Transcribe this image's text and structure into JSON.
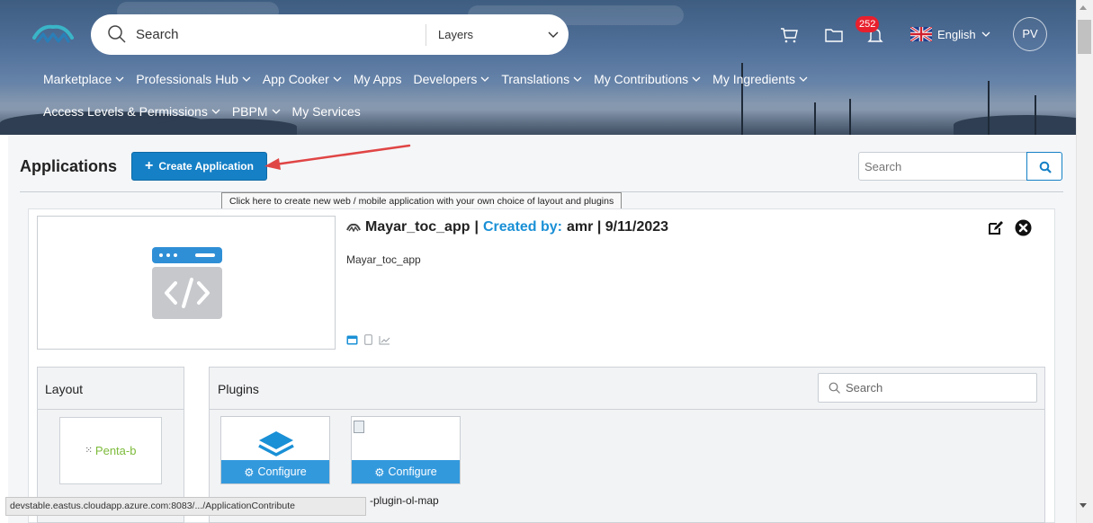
{
  "header": {
    "search_placeholder": "Search",
    "layer_select": "Layers",
    "notifications_count": "252",
    "language": "English",
    "user_initials": "PV",
    "nav_row1": [
      {
        "label": "Marketplace",
        "dropdown": true
      },
      {
        "label": "Professionals Hub",
        "dropdown": true
      },
      {
        "label": "App Cooker",
        "dropdown": true
      },
      {
        "label": "My Apps",
        "dropdown": false
      },
      {
        "label": "Developers",
        "dropdown": true
      },
      {
        "label": "Translations",
        "dropdown": true
      },
      {
        "label": "My Contributions",
        "dropdown": true
      },
      {
        "label": "My Ingredients",
        "dropdown": true
      }
    ],
    "nav_row2": [
      {
        "label": "Access Levels & Permissions",
        "dropdown": true
      },
      {
        "label": "PBPM",
        "dropdown": true
      },
      {
        "label": "My Services",
        "dropdown": false
      }
    ]
  },
  "page": {
    "title": "Applications",
    "create_button": "Create Application",
    "create_tooltip": "Click here to create new web / mobile application with your own choice of layout and plugins",
    "search_placeholder": "Search"
  },
  "app": {
    "name": "Mayar_toc_app",
    "separator": "|",
    "created_by_label": "Created by:",
    "created_by": "amr | 9/11/2023",
    "description": "Mayar_toc_app",
    "platforms": [
      "web-icon",
      "mobile-icon",
      "analytics-icon"
    ],
    "layout_label": "Layout",
    "plugins_label": "Plugins",
    "plugins_search_placeholder": "Search",
    "layout_name": "Penta-b",
    "plugins": [
      {
        "configure_label": "Configure"
      },
      {
        "configure_label": "Configure"
      }
    ],
    "plugin_caption": "-plugin-ol-map"
  },
  "status_bar": "devstable.eastus.cloudapp.azure.com:8083/.../ApplicationContribute",
  "colors": {
    "primary": "#1580c6",
    "accent_text": "#1a90d6",
    "configure_bg": "#3399dd",
    "badge": "#e8202e"
  }
}
